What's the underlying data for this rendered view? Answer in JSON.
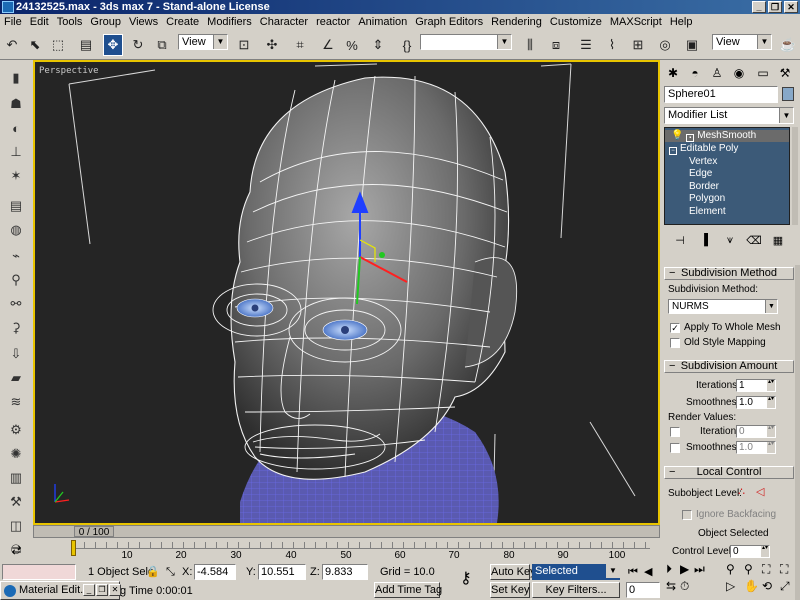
{
  "window": {
    "title": "24132525.max - 3ds max 7 - Stand-alone License"
  },
  "menu": [
    "File",
    "Edit",
    "Tools",
    "Group",
    "Views",
    "Create",
    "Modifiers",
    "Character",
    "reactor",
    "Animation",
    "Graph Editors",
    "Rendering",
    "Customize",
    "MAXScript",
    "Help"
  ],
  "toolbar": {
    "ref_coord": "View",
    "named_selection": "",
    "view_dropdown": "View"
  },
  "viewport": {
    "label": "Perspective"
  },
  "timeslider": {
    "frame": "0 / 100"
  },
  "trackbar": {
    "ticks": [
      "10",
      "20",
      "30",
      "40",
      "50",
      "60",
      "70",
      "80",
      "90",
      "100"
    ]
  },
  "status": {
    "selection": "1 Object Sele",
    "x_label": "X:",
    "x_value": "-4.584",
    "y_label": "Y:",
    "y_value": "10.551",
    "z_label": "Z:",
    "z_value": "9.833",
    "grid": "Grid = 10.0",
    "auto_key": "Auto Key",
    "set_key": "Set Key",
    "selected": "Selected",
    "key_filters": "Key Filters...",
    "add_time_tag": "Add Time Tag",
    "render_time": "g Time  0:00:01",
    "material_editor": "Material Edit...",
    "current_frame": "0"
  },
  "command_panel": {
    "object_name": "Sphere01",
    "object_color": "#87a8c8",
    "modifier_list": "Modifier List",
    "stack": [
      "MeshSmooth",
      "Editable Poly",
      "Vertex",
      "Edge",
      "Border",
      "Polygon",
      "Element"
    ],
    "subdivision_method_title": "Subdivision Method",
    "subdivision_method_label": "Subdivision Method:",
    "subdivision_method_value": "NURMS",
    "apply_to_whole_mesh": "Apply To Whole Mesh",
    "old_style_mapping": "Old Style Mapping",
    "subdivision_amount_title": "Subdivision Amount",
    "iterations_label": "Iterations:",
    "iterations_value": "1",
    "smoothness_label": "Smoothness:",
    "smoothness_value": "1.0",
    "render_values_label": "Render Values:",
    "render_iterations_label": "Iterations:",
    "render_iterations_value": "0",
    "render_smoothness_label": "Smoothness:",
    "render_smoothness_value": "1.0",
    "local_control_title": "Local Control",
    "subobject_level_label": "Subobject Level:",
    "ignore_backfacing": "Ignore Backfacing",
    "object_selected": "Object Selected",
    "control_level_label": "Control Level:",
    "control_level_value": "0"
  }
}
